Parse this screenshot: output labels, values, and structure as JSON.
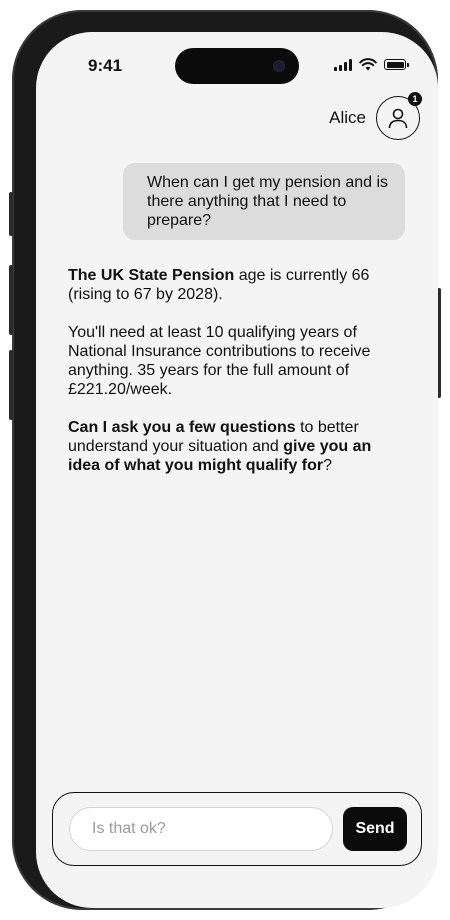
{
  "status_bar": {
    "time": "9:41",
    "icons": [
      "signal-icon",
      "wifi-icon",
      "battery-icon"
    ]
  },
  "user": {
    "name": "Alice",
    "notification_count": "1",
    "avatar_icon": "person-icon"
  },
  "messages": {
    "user_message": "When can I get my pension and is there anything that I need to prepare?",
    "assistant": {
      "p1_bold": "The UK State Pension",
      "p1_rest": " age is currently 66 (rising to 67 by 2028).",
      "p2": "You'll need at least 10 qualifying years of National Insurance contributions to receive anything. 35 years for the full amount of £221.20/week.",
      "p3_bold_1": "Can I ask you a few questions",
      "p3_mid": " to better understand your situation and ",
      "p3_bold_2": "give you an idea of what you might qualify for",
      "p3_end": "?"
    }
  },
  "composer": {
    "placeholder": "Is that ok?",
    "value": "",
    "send_label": "Send"
  },
  "colors": {
    "background": "#f4f4f4",
    "user_bubble": "#dcdcdc",
    "send_button": "#0b0b0b",
    "frame": "#1a1a1a"
  }
}
